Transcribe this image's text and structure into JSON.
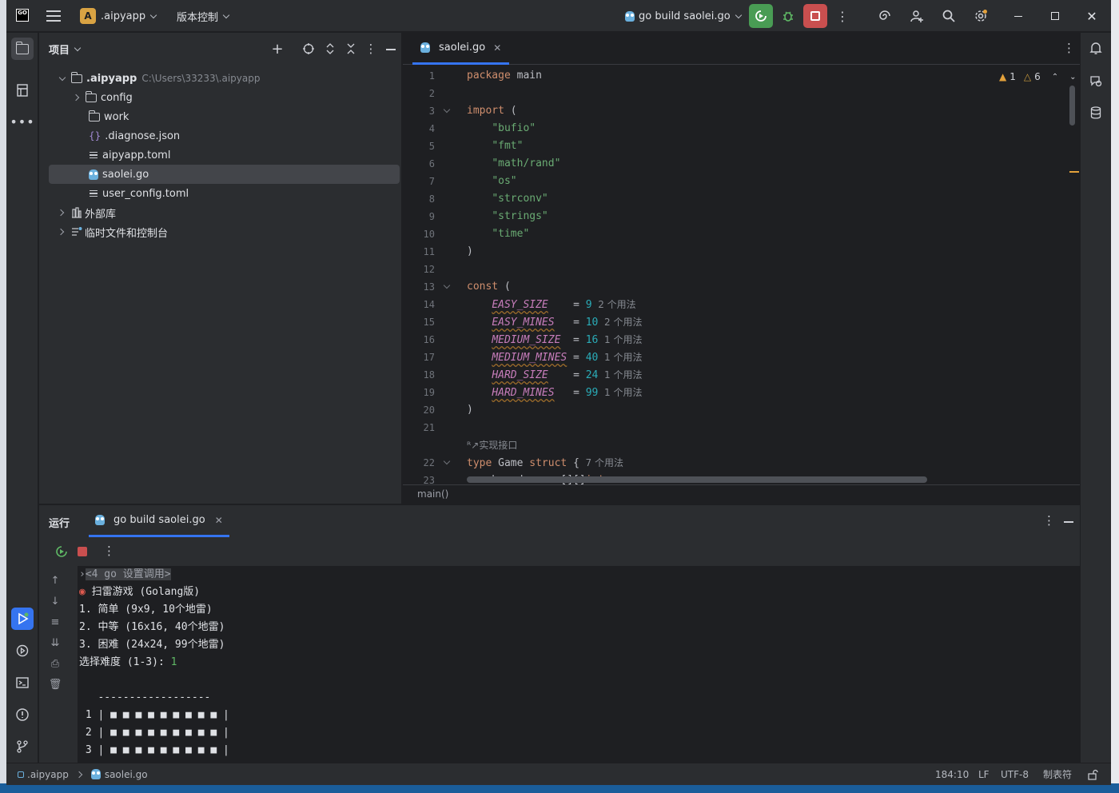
{
  "titlebar": {
    "app_logo": "GO",
    "project_badge": "A",
    "project_name": ".aipyapp",
    "vcs_menu": "版本控制",
    "run_config": "go build saolei.go"
  },
  "project_panel": {
    "title": "项目",
    "tree": [
      {
        "label": ".aipyapp",
        "path": "C:\\Users\\33233\\.aipyapp",
        "icon": "folder-icon"
      },
      {
        "label": "config",
        "icon": "folder-icon"
      },
      {
        "label": "work",
        "icon": "folder-icon"
      },
      {
        "label": ".diagnose.json",
        "icon": "json-icon"
      },
      {
        "label": "aipyapp.toml",
        "icon": "text-file-icon"
      },
      {
        "label": "saolei.go",
        "icon": "go-file-icon"
      },
      {
        "label": "user_config.toml",
        "icon": "text-file-icon"
      },
      {
        "label": "外部库",
        "icon": "library-icon"
      },
      {
        "label": "临时文件和控制台",
        "icon": "scratch-icon"
      }
    ]
  },
  "editor": {
    "tab": "saolei.go",
    "warnings": "1",
    "weak_warnings": "6",
    "breadcrumb": "main()",
    "implements_hint": "实现接口",
    "hints": {
      "two_uses": "2 个用法",
      "one_use": "1 个用法",
      "seven_uses": "7 个用法"
    },
    "lines": {
      "l1_kw": "package",
      "l1_rest": " main",
      "l3_kw": "import",
      "l3_rest": " (",
      "imports": [
        "\"bufio\"",
        "\"fmt\"",
        "\"math/rand\"",
        "\"os\"",
        "\"strconv\"",
        "\"strings\"",
        "\"time\""
      ],
      "close": ")",
      "l13_kw": "const",
      "l13_rest": " (",
      "consts": [
        {
          "name": "EASY_SIZE",
          "pad": "    = ",
          "val": "9",
          "hint": "2 个用法"
        },
        {
          "name": "EASY_MINES",
          "pad": "   = ",
          "val": "10",
          "hint": "2 个用法"
        },
        {
          "name": "MEDIUM_SIZE",
          "pad": "  = ",
          "val": "16",
          "hint": "1 个用法"
        },
        {
          "name": "MEDIUM_MINES",
          "pad": " = ",
          "val": "40",
          "hint": "1 个用法"
        },
        {
          "name": "HARD_SIZE",
          "pad": "    = ",
          "val": "24",
          "hint": "1 个用法"
        },
        {
          "name": "HARD_MINES",
          "pad": "   = ",
          "val": "99",
          "hint": "1 个用法"
        }
      ],
      "l22_kw1": "type",
      "l22_name": " Game ",
      "l22_kw2": "struct",
      "l22_rest": " {",
      "l23_field": "    board      [][]",
      "l23_type": "int"
    }
  },
  "run_panel": {
    "title": "运行",
    "tab": "go build saolei.go",
    "console": [
      "<4 go 设置调用>",
      "扫雷游戏 (Golang版)",
      "1. 简单 (9x9, 10个地雷)",
      "2. 中等 (16x16, 40个地雷)",
      "3. 困难 (24x24, 99个地雷)",
      "选择难度 (1-3): ",
      "1",
      "",
      "   ------------------",
      " 1 | ■ ■ ■ ■ ■ ■ ■ ■ ■ |",
      " 2 | ■ ■ ■ ■ ■ ■ ■ ■ ■ |",
      " 3 | ■ ■ ■ ■ ■ ■ ■ ■ ■ |"
    ]
  },
  "statusbar": {
    "crumb_project": ".aipyapp",
    "crumb_file": "saolei.go",
    "position": "184:10",
    "line_sep": "LF",
    "encoding": "UTF-8",
    "indent": "制表符"
  },
  "colors": {
    "accent": "#3574f0",
    "run_green": "#499c54",
    "stop_red": "#c94f4f",
    "keyword": "#cf8e6d",
    "string": "#6aab73",
    "constant": "#c77dbb",
    "number": "#2aacb8"
  }
}
